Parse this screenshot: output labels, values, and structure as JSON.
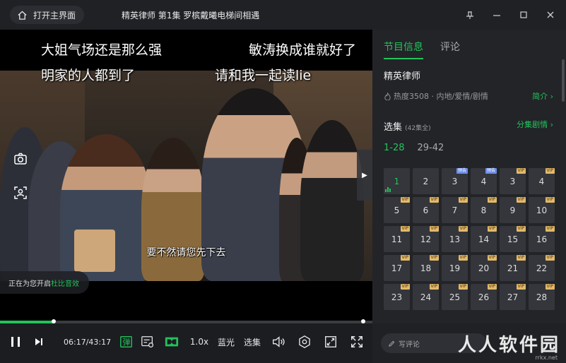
{
  "titlebar": {
    "home_label": "打开主界面",
    "title": "精英律师 第1集 罗槟戴曦电梯间相遇"
  },
  "video": {
    "danmu": [
      {
        "text": "大姐气场还是那么强"
      },
      {
        "text": "敏涛换成谁就好了"
      },
      {
        "text": "明家的人都到了"
      },
      {
        "text": "请和我一起读lie"
      }
    ],
    "subtitle": "要不然请您先下去",
    "toast_prefix": "正在为您开启",
    "toast_highlight": "杜比音效"
  },
  "player": {
    "progress": 0.145,
    "time": "06:17/43:17",
    "danmu_label": "弹",
    "speed": "1.0x",
    "quality": "蓝光",
    "episodes": "选集"
  },
  "panel": {
    "tabs": [
      {
        "label": "节目信息"
      },
      {
        "label": "评论"
      }
    ],
    "show_title": "精英律师",
    "meta": "热度3508 · 内地/爱情/剧情",
    "intro_link": "简介 ›",
    "ep_header": "选集",
    "ep_count": "(42集全)",
    "plot_link": "分集剧情 ›",
    "ranges": [
      {
        "label": "1-28"
      },
      {
        "label": "29-42"
      }
    ],
    "episodes": [
      {
        "num": "1",
        "badge": "",
        "current": true
      },
      {
        "num": "2",
        "badge": ""
      },
      {
        "num": "3",
        "badge": "预告"
      },
      {
        "num": "4",
        "badge": "预告"
      },
      {
        "num": "3",
        "badge": "VIP"
      },
      {
        "num": "4",
        "badge": "VIP"
      },
      {
        "num": "5",
        "badge": "VIP"
      },
      {
        "num": "6",
        "badge": "VIP"
      },
      {
        "num": "7",
        "badge": "VIP"
      },
      {
        "num": "8",
        "badge": "VIP"
      },
      {
        "num": "9",
        "badge": "VIP"
      },
      {
        "num": "10",
        "badge": "VIP"
      },
      {
        "num": "11",
        "badge": "VIP"
      },
      {
        "num": "12",
        "badge": "VIP"
      },
      {
        "num": "13",
        "badge": "VIP"
      },
      {
        "num": "14",
        "badge": "VIP"
      },
      {
        "num": "15",
        "badge": "VIP"
      },
      {
        "num": "16",
        "badge": "VIP"
      },
      {
        "num": "17",
        "badge": "VIP"
      },
      {
        "num": "18",
        "badge": "VIP"
      },
      {
        "num": "19",
        "badge": "VIP"
      },
      {
        "num": "20",
        "badge": "VIP"
      },
      {
        "num": "21",
        "badge": "VIP"
      },
      {
        "num": "22",
        "badge": "VIP"
      },
      {
        "num": "23",
        "badge": "VIP"
      },
      {
        "num": "24",
        "badge": "VIP"
      },
      {
        "num": "25",
        "badge": "VIP"
      },
      {
        "num": "26",
        "badge": "VIP"
      },
      {
        "num": "27",
        "badge": "VIP"
      },
      {
        "num": "28",
        "badge": "VIP"
      }
    ],
    "comment_placeholder": "写评论",
    "watermark": "人人软件园",
    "watermark_sub": "rrkx.net"
  },
  "colors": {
    "accent": "#22c35a",
    "vip_badge": "#e3b969",
    "preview_badge": "#6c8ee8"
  }
}
